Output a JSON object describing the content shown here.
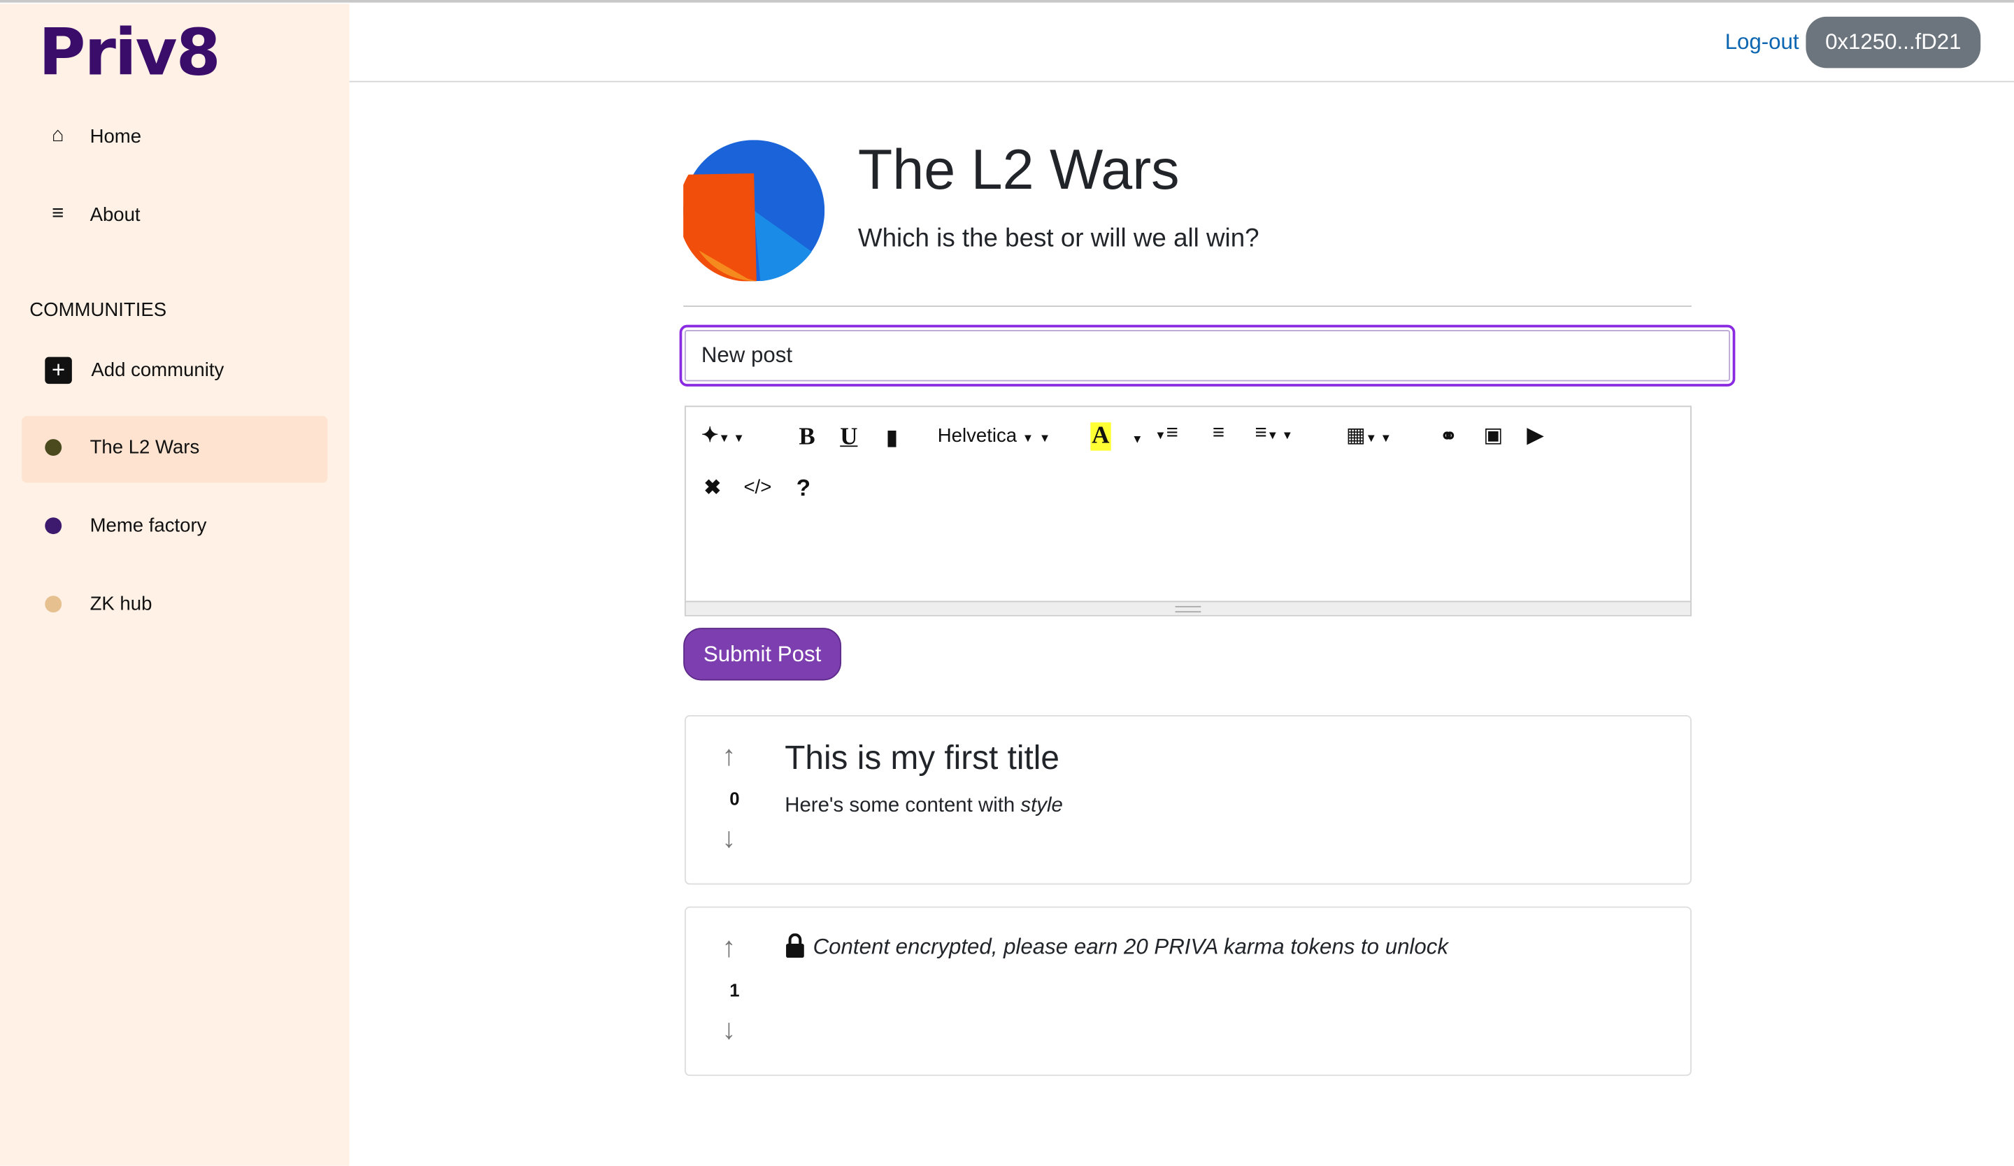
{
  "app": {
    "logo": "Priv8"
  },
  "sidebar": {
    "nav": [
      {
        "label": "Home",
        "icon": "home-icon"
      },
      {
        "label": "About",
        "icon": "menu-lines-icon"
      }
    ],
    "communities_heading": "COMMUNITIES",
    "add_community": "Add community",
    "communities": [
      {
        "label": "The L2 Wars",
        "color": "#4b4a1e",
        "selected": true
      },
      {
        "label": "Meme factory",
        "color": "#3d1a6e",
        "selected": false
      },
      {
        "label": "ZK hub",
        "color": "#e6c08e",
        "selected": false
      }
    ]
  },
  "header": {
    "logout": "Log-out",
    "address": "0x1250...fD21"
  },
  "community": {
    "title": "The L2 Wars",
    "subtitle": "Which is the best or will we all win?"
  },
  "composer": {
    "title_value": "New post",
    "font": "Helvetica",
    "submit": "Submit Post"
  },
  "posts": [
    {
      "votes": "0",
      "title": "This is my first title",
      "content": "Here's some content with ",
      "content_em": "style"
    },
    {
      "votes": "1",
      "locked_text": "Content encrypted, please earn 20 PRIVA karma tokens to unlock"
    }
  ],
  "colors": {
    "brand": "#3b0d6b",
    "accent": "#7d3fb0",
    "focus": "#8a2be2",
    "sidebar": "#fff1e6"
  }
}
